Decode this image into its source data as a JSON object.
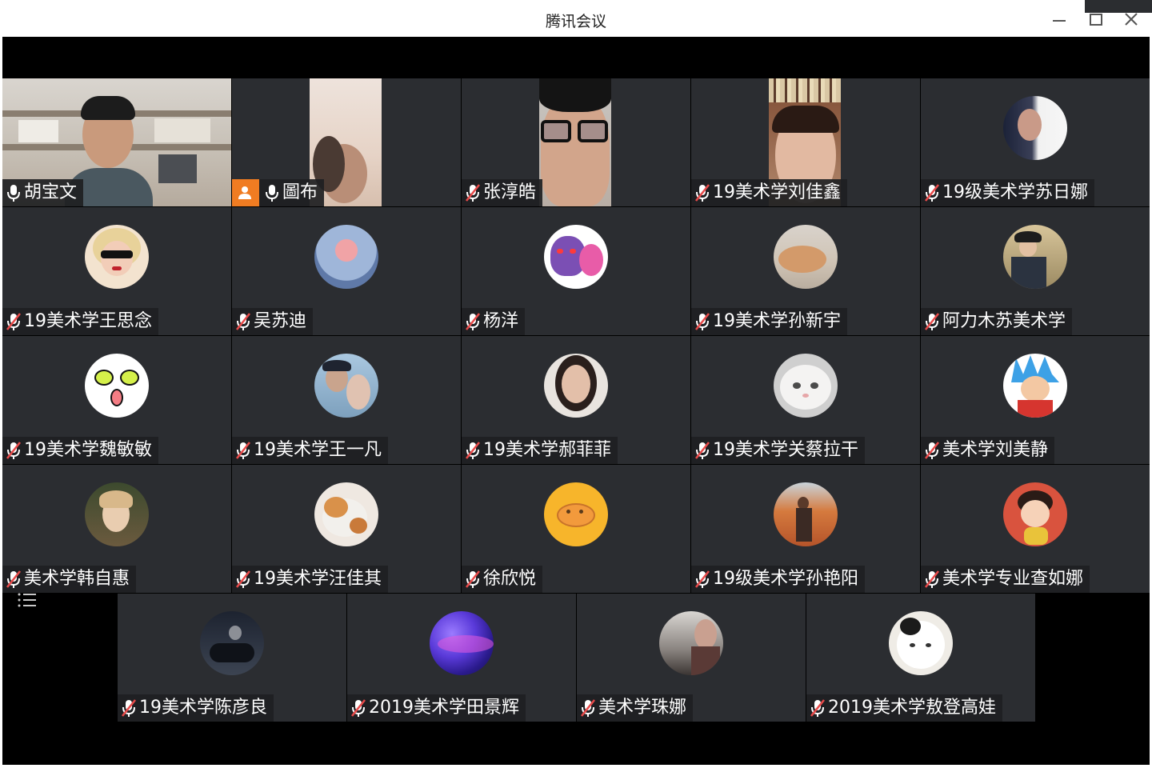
{
  "window": {
    "title": "腾讯会议"
  },
  "participants": [
    {
      "name": "胡宝文",
      "mic": "on",
      "camera": "on"
    },
    {
      "name": "圖布",
      "mic": "on",
      "camera": "on",
      "host": true
    },
    {
      "name": "张淳皓",
      "mic": "muted",
      "camera": "on"
    },
    {
      "name": "19美术学刘佳鑫",
      "mic": "muted",
      "camera": "on"
    },
    {
      "name": "19级美术学苏日娜",
      "mic": "muted",
      "camera": "off"
    },
    {
      "name": "19美术学王思念",
      "mic": "muted",
      "camera": "off"
    },
    {
      "name": "吴苏迪",
      "mic": "muted",
      "camera": "off"
    },
    {
      "name": "杨洋",
      "mic": "muted",
      "camera": "off"
    },
    {
      "name": "19美术学孙新宇",
      "mic": "muted",
      "camera": "off"
    },
    {
      "name": "阿力木苏美术学",
      "mic": "muted",
      "camera": "off"
    },
    {
      "name": "19美术学魏敏敏",
      "mic": "muted",
      "camera": "off"
    },
    {
      "name": "19美术学王一凡",
      "mic": "muted",
      "camera": "off"
    },
    {
      "name": "19美术学郝菲菲",
      "mic": "muted",
      "camera": "off"
    },
    {
      "name": "19美术学关蔡拉干",
      "mic": "muted",
      "camera": "off"
    },
    {
      "name": "美术学刘美静",
      "mic": "muted",
      "camera": "off"
    },
    {
      "name": "美术学韩自惠",
      "mic": "muted",
      "camera": "off"
    },
    {
      "name": "19美术学汪佳其",
      "mic": "muted",
      "camera": "off"
    },
    {
      "name": "徐欣悦",
      "mic": "muted",
      "camera": "off"
    },
    {
      "name": "19级美术学孙艳阳",
      "mic": "muted",
      "camera": "off"
    },
    {
      "name": "美术学专业查如娜",
      "mic": "muted",
      "camera": "off"
    },
    {
      "name": "19美术学陈彦良",
      "mic": "muted",
      "camera": "off"
    },
    {
      "name": "2019美术学田景辉",
      "mic": "muted",
      "camera": "off"
    },
    {
      "name": "美术学珠娜",
      "mic": "muted",
      "camera": "off"
    },
    {
      "name": "2019美术学敖登高娃",
      "mic": "muted",
      "camera": "off"
    }
  ],
  "icons": {
    "window_controls": [
      "minimize-icon",
      "maximize-icon",
      "close-icon"
    ],
    "mic_on": "microphone-icon",
    "mic_muted": "microphone-muted-icon",
    "host_badge": "host-user-icon",
    "list": "participant-list-icon"
  },
  "colors": {
    "stage_bg": "#000000",
    "tile_bg": "#2b2d31",
    "host_badge": "#f07c22",
    "muted_icon": "#e84a4a"
  }
}
